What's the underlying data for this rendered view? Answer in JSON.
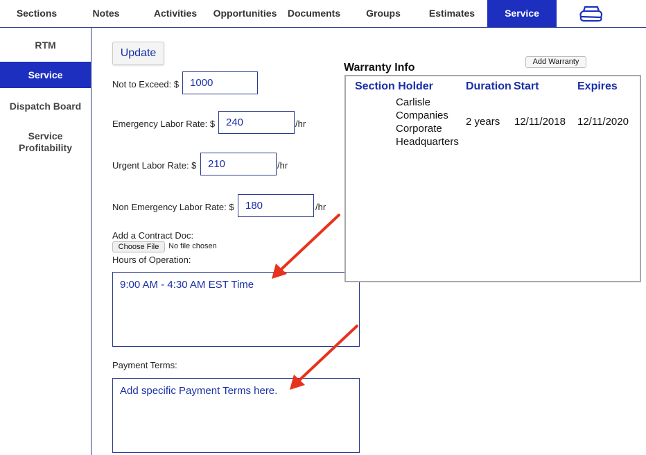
{
  "topnav": {
    "tabs": [
      {
        "label": "Sections",
        "active": false
      },
      {
        "label": "Notes",
        "active": false
      },
      {
        "label": "Activities",
        "active": false
      },
      {
        "label": "Opportunities",
        "active": false
      },
      {
        "label": "Documents",
        "active": false
      },
      {
        "label": "Groups",
        "active": false
      },
      {
        "label": "Estimates",
        "active": false
      },
      {
        "label": "Service",
        "active": true
      }
    ],
    "icon": "cloud-stack-icon"
  },
  "sidebar": {
    "items": [
      {
        "label": "RTM",
        "active": false
      },
      {
        "label": "Service",
        "active": true
      },
      {
        "label": "Dispatch Board",
        "active": false
      },
      {
        "label": "Service Profitability",
        "active": false
      }
    ]
  },
  "form": {
    "update_label": "Update",
    "not_to_exceed_label": "Not to Exceed: $",
    "not_to_exceed_value": "1000",
    "emergency_label": "Emergency Labor Rate: $",
    "emergency_value": "240",
    "urgent_label": "Urgent Labor Rate: $",
    "urgent_value": "210",
    "non_emergency_label": "Non Emergency Labor Rate: $",
    "non_emergency_value": "180",
    "per_hour": "/hr",
    "contract_doc_label": "Add a Contract Doc:",
    "choose_file_label": "Choose File",
    "no_file_text": "No file chosen",
    "hours_label": "Hours of Operation:",
    "hours_value": "9:00 AM - 4:30 AM EST Time",
    "payment_label": "Payment Terms:",
    "payment_value": "Add specific Payment Terms here."
  },
  "warranty": {
    "add_label": "Add Warranty",
    "title": "Warranty Info",
    "columns": [
      "Section Holder",
      "Duration",
      "Start",
      "Expires"
    ],
    "rows": [
      {
        "holder": "Carlisle Companies Corporate Headquarters",
        "duration": "2 years",
        "start": "12/11/2018",
        "expires": "12/11/2020"
      }
    ]
  },
  "colors": {
    "accent": "#1c2fbf",
    "link_text": "#1a2fa8",
    "annotation_arrow": "#e8321e"
  }
}
